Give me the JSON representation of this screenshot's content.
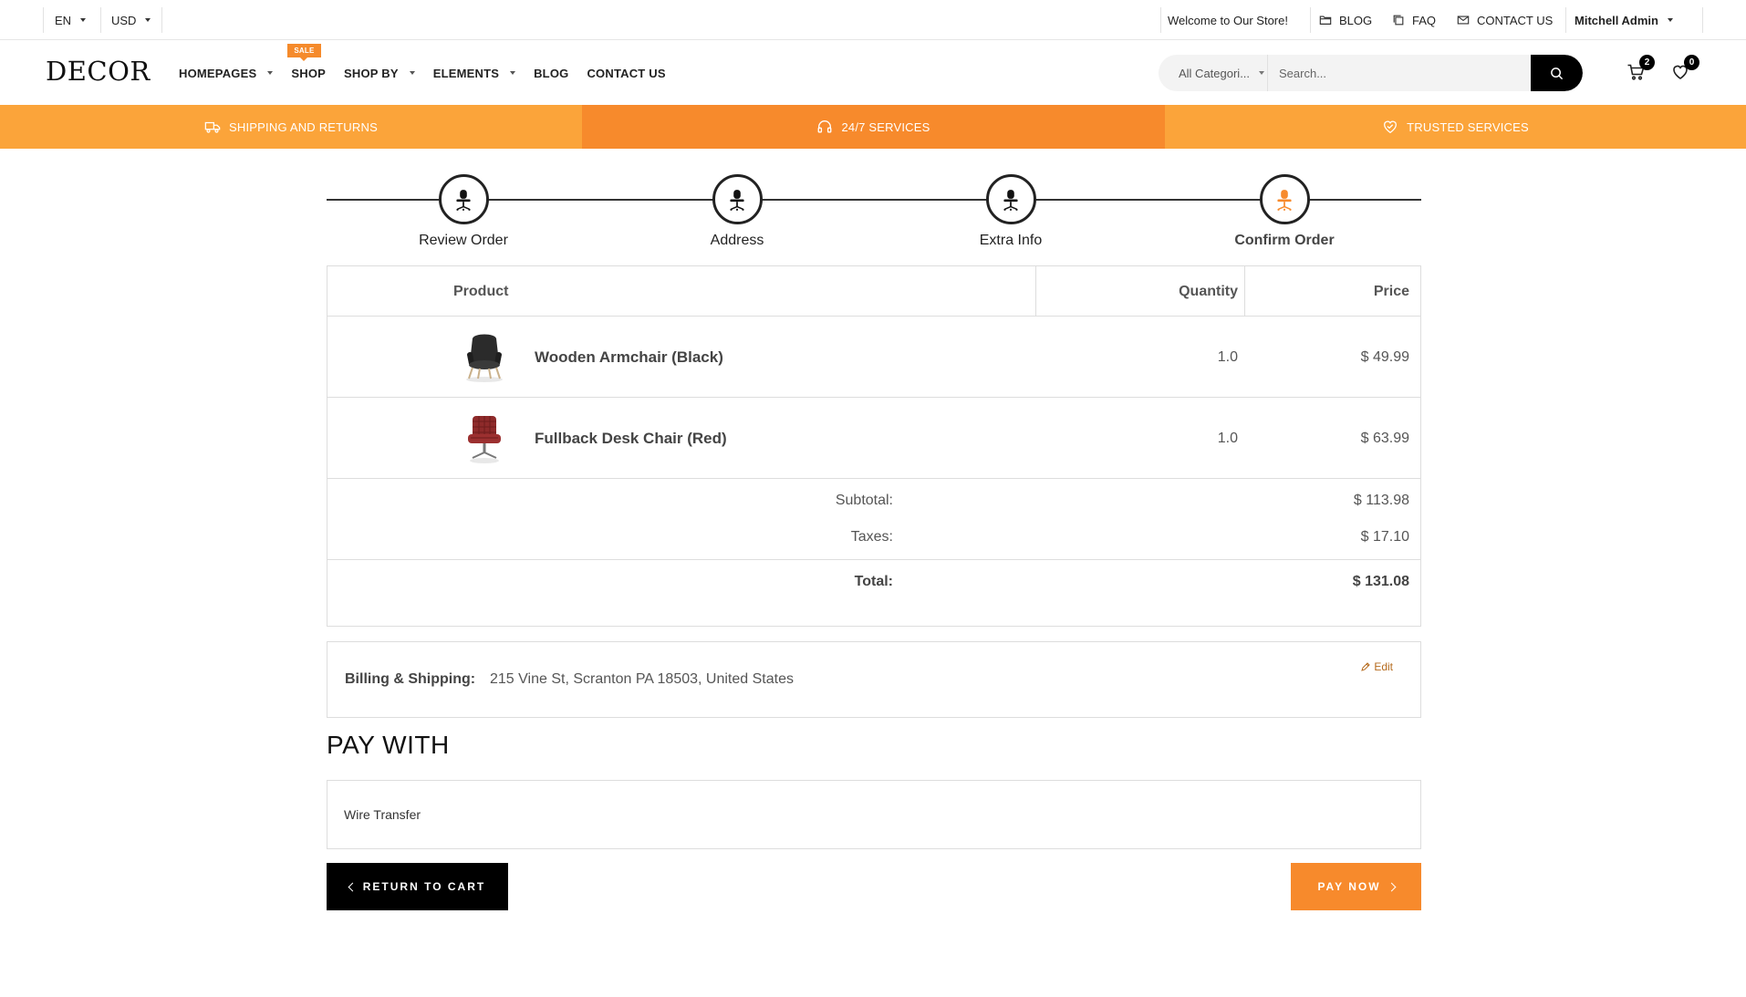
{
  "topbar": {
    "language": "EN",
    "currency": "USD",
    "welcome": "Welcome to Our Store!",
    "blog": "BLOG",
    "faq": "FAQ",
    "contact": "CONTACT US",
    "user": "Mitchell Admin"
  },
  "header": {
    "logo": "DECOR",
    "nav": [
      {
        "label": "HOMEPAGES",
        "dropdown": true
      },
      {
        "label": "SHOP",
        "dropdown": false,
        "badge": "SALE"
      },
      {
        "label": "SHOP BY",
        "dropdown": true
      },
      {
        "label": "ELEMENTS",
        "dropdown": true
      },
      {
        "label": "BLOG",
        "dropdown": false
      },
      {
        "label": "CONTACT US",
        "dropdown": false
      }
    ],
    "search": {
      "category": "All Categori...",
      "placeholder": "Search..."
    },
    "cart_count": "2",
    "wishlist_count": "0"
  },
  "promo": {
    "shipping": "SHIPPING AND RETURNS",
    "services": "24/7 SERVICES",
    "trusted": "TRUSTED SERVICES"
  },
  "steps": [
    {
      "label": "Review Order",
      "active": false
    },
    {
      "label": "Address",
      "active": false
    },
    {
      "label": "Extra Info",
      "active": false
    },
    {
      "label": "Confirm Order",
      "active": true
    }
  ],
  "order": {
    "headers": {
      "product": "Product",
      "quantity": "Quantity",
      "price": "Price"
    },
    "items": [
      {
        "name": "Wooden Armchair (Black)",
        "quantity": "1.0",
        "price": "$ 49.99",
        "image": "black-armchair-image"
      },
      {
        "name": "Fullback Desk Chair (Red)",
        "quantity": "1.0",
        "price": "$ 63.99",
        "image": "red-desk-chair-image"
      }
    ],
    "subtotal_label": "Subtotal:",
    "subtotal": "$ 113.98",
    "taxes_label": "Taxes:",
    "taxes": "$ 17.10",
    "total_label": "Total:",
    "total": "$ 131.08"
  },
  "billing": {
    "label": "Billing & Shipping:",
    "address": "215 Vine St, Scranton PA 18503, United States",
    "edit": "Edit"
  },
  "payment": {
    "title": "PAY WITH",
    "method": "Wire Transfer"
  },
  "buttons": {
    "return": "RETURN TO CART",
    "pay": "PAY NOW"
  },
  "colors": {
    "accent": "#f78a2c",
    "accent_light": "#fba43a",
    "dark": "#000000"
  }
}
